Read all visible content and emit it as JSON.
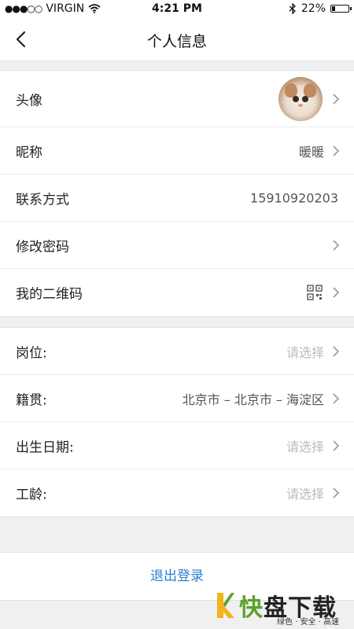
{
  "status_bar": {
    "carrier": "VIRGIN",
    "time": "4:21 PM",
    "battery": "22%",
    "battery_level": 0.22
  },
  "nav": {
    "title": "个人信息"
  },
  "profile": {
    "avatar_label": "头像",
    "nickname_label": "昵称",
    "nickname_value": "暖暖",
    "contact_label": "联系方式",
    "contact_value": "15910920203",
    "password_label": "修改密码",
    "qrcode_label": "我的二维码"
  },
  "details": {
    "position_label": "岗位:",
    "position_value": "请选择",
    "hometown_label": "籍贯:",
    "hometown_value": "北京市 – 北京市 – 海淀区",
    "birthday_label": "出生日期:",
    "birthday_value": "请选择",
    "seniority_label": "工龄:",
    "seniority_value": "请选择"
  },
  "logout": {
    "label": "退出登录"
  },
  "watermark": {
    "brand_green": "快",
    "brand_dark": "盘下载",
    "tagline": "绿色 · 安全 · 高速"
  },
  "colors": {
    "accent": "#2a7fd4",
    "placeholder": "#bbbbbb",
    "background": "#f0f0f0",
    "watermark_green": "#5aa22a"
  }
}
